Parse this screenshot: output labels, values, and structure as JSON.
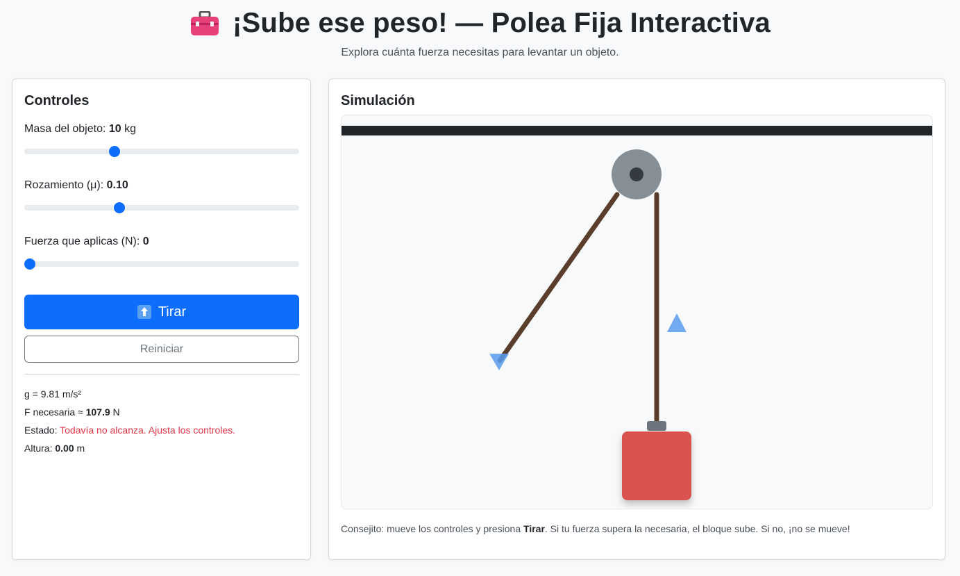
{
  "header": {
    "title": "¡Sube ese peso! — Polea Fija Interactiva",
    "subtitle": "Explora cuánta fuerza necesitas para levantar un objeto.",
    "icon": "toolbox-icon"
  },
  "controls": {
    "title": "Controles",
    "mass": {
      "label": "Masa del objeto:",
      "value": "10",
      "unit": "kg",
      "fraction": 0.32
    },
    "friction": {
      "label": "Rozamiento (μ):",
      "value": "0.10",
      "fraction": 0.34
    },
    "force": {
      "label": "Fuerza que aplicas (N):",
      "value": "0",
      "fraction": 0.0
    },
    "pull_button": "Tirar",
    "reset_button": "Reiniciar",
    "info": {
      "g": "g = 9.81 m/s²",
      "needed_label": "F necesaria ≈",
      "needed_value": "107.9",
      "needed_unit": "N",
      "status_label": "Estado:",
      "status_value": "Todavía no alcanza. Ajusta los controles.",
      "height_label": "Altura:",
      "height_value": "0.00",
      "height_unit": "m"
    }
  },
  "simulation": {
    "title": "Simulación",
    "tip_before": "Consejito: mueve los controles y presiona ",
    "tip_bold": "Tirar",
    "tip_after": ". Si tu fuerza supera la necesaria, el bloque sube. Si no, ¡no se mueve!"
  },
  "colors": {
    "primary": "#0d6efd",
    "danger": "#dc3545",
    "rope": "#5a3e2b",
    "block": "#d9534f",
    "pulley": "#868e96",
    "beam": "#212529",
    "arrow": "#5b9cf0"
  }
}
